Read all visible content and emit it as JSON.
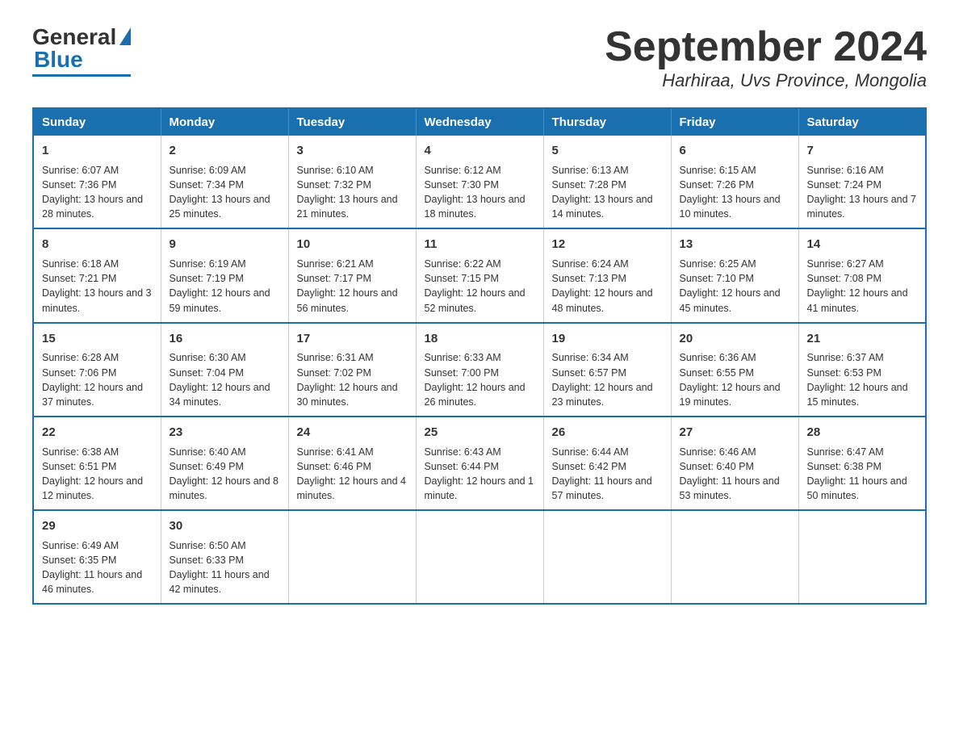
{
  "logo": {
    "general": "General",
    "blue": "Blue"
  },
  "title": "September 2024",
  "location": "Harhiraa, Uvs Province, Mongolia",
  "days": [
    "Sunday",
    "Monday",
    "Tuesday",
    "Wednesday",
    "Thursday",
    "Friday",
    "Saturday"
  ],
  "weeks": [
    [
      {
        "num": "1",
        "sunrise": "6:07 AM",
        "sunset": "7:36 PM",
        "daylight": "13 hours and 28 minutes."
      },
      {
        "num": "2",
        "sunrise": "6:09 AM",
        "sunset": "7:34 PM",
        "daylight": "13 hours and 25 minutes."
      },
      {
        "num": "3",
        "sunrise": "6:10 AM",
        "sunset": "7:32 PM",
        "daylight": "13 hours and 21 minutes."
      },
      {
        "num": "4",
        "sunrise": "6:12 AM",
        "sunset": "7:30 PM",
        "daylight": "13 hours and 18 minutes."
      },
      {
        "num": "5",
        "sunrise": "6:13 AM",
        "sunset": "7:28 PM",
        "daylight": "13 hours and 14 minutes."
      },
      {
        "num": "6",
        "sunrise": "6:15 AM",
        "sunset": "7:26 PM",
        "daylight": "13 hours and 10 minutes."
      },
      {
        "num": "7",
        "sunrise": "6:16 AM",
        "sunset": "7:24 PM",
        "daylight": "13 hours and 7 minutes."
      }
    ],
    [
      {
        "num": "8",
        "sunrise": "6:18 AM",
        "sunset": "7:21 PM",
        "daylight": "13 hours and 3 minutes."
      },
      {
        "num": "9",
        "sunrise": "6:19 AM",
        "sunset": "7:19 PM",
        "daylight": "12 hours and 59 minutes."
      },
      {
        "num": "10",
        "sunrise": "6:21 AM",
        "sunset": "7:17 PM",
        "daylight": "12 hours and 56 minutes."
      },
      {
        "num": "11",
        "sunrise": "6:22 AM",
        "sunset": "7:15 PM",
        "daylight": "12 hours and 52 minutes."
      },
      {
        "num": "12",
        "sunrise": "6:24 AM",
        "sunset": "7:13 PM",
        "daylight": "12 hours and 48 minutes."
      },
      {
        "num": "13",
        "sunrise": "6:25 AM",
        "sunset": "7:10 PM",
        "daylight": "12 hours and 45 minutes."
      },
      {
        "num": "14",
        "sunrise": "6:27 AM",
        "sunset": "7:08 PM",
        "daylight": "12 hours and 41 minutes."
      }
    ],
    [
      {
        "num": "15",
        "sunrise": "6:28 AM",
        "sunset": "7:06 PM",
        "daylight": "12 hours and 37 minutes."
      },
      {
        "num": "16",
        "sunrise": "6:30 AM",
        "sunset": "7:04 PM",
        "daylight": "12 hours and 34 minutes."
      },
      {
        "num": "17",
        "sunrise": "6:31 AM",
        "sunset": "7:02 PM",
        "daylight": "12 hours and 30 minutes."
      },
      {
        "num": "18",
        "sunrise": "6:33 AM",
        "sunset": "7:00 PM",
        "daylight": "12 hours and 26 minutes."
      },
      {
        "num": "19",
        "sunrise": "6:34 AM",
        "sunset": "6:57 PM",
        "daylight": "12 hours and 23 minutes."
      },
      {
        "num": "20",
        "sunrise": "6:36 AM",
        "sunset": "6:55 PM",
        "daylight": "12 hours and 19 minutes."
      },
      {
        "num": "21",
        "sunrise": "6:37 AM",
        "sunset": "6:53 PM",
        "daylight": "12 hours and 15 minutes."
      }
    ],
    [
      {
        "num": "22",
        "sunrise": "6:38 AM",
        "sunset": "6:51 PM",
        "daylight": "12 hours and 12 minutes."
      },
      {
        "num": "23",
        "sunrise": "6:40 AM",
        "sunset": "6:49 PM",
        "daylight": "12 hours and 8 minutes."
      },
      {
        "num": "24",
        "sunrise": "6:41 AM",
        "sunset": "6:46 PM",
        "daylight": "12 hours and 4 minutes."
      },
      {
        "num": "25",
        "sunrise": "6:43 AM",
        "sunset": "6:44 PM",
        "daylight": "12 hours and 1 minute."
      },
      {
        "num": "26",
        "sunrise": "6:44 AM",
        "sunset": "6:42 PM",
        "daylight": "11 hours and 57 minutes."
      },
      {
        "num": "27",
        "sunrise": "6:46 AM",
        "sunset": "6:40 PM",
        "daylight": "11 hours and 53 minutes."
      },
      {
        "num": "28",
        "sunrise": "6:47 AM",
        "sunset": "6:38 PM",
        "daylight": "11 hours and 50 minutes."
      }
    ],
    [
      {
        "num": "29",
        "sunrise": "6:49 AM",
        "sunset": "6:35 PM",
        "daylight": "11 hours and 46 minutes."
      },
      {
        "num": "30",
        "sunrise": "6:50 AM",
        "sunset": "6:33 PM",
        "daylight": "11 hours and 42 minutes."
      },
      null,
      null,
      null,
      null,
      null
    ]
  ],
  "labels": {
    "sunrise": "Sunrise:",
    "sunset": "Sunset:",
    "daylight": "Daylight:"
  }
}
